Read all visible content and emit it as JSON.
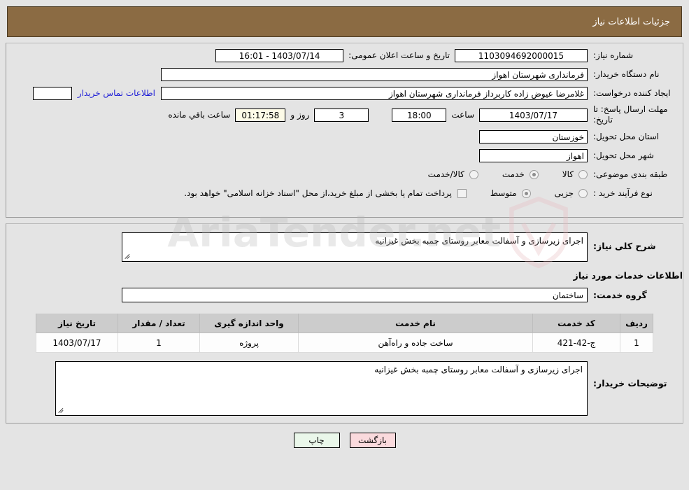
{
  "header": {
    "title": "جزئیات اطلاعات نیاز"
  },
  "top_form": {
    "need_number_label": "شماره نیاز:",
    "need_number_value": "1103094692000015",
    "announce_label": "تاریخ و ساعت اعلان عمومی:",
    "announce_value": "1403/07/14 - 16:01",
    "buyer_org_label": "نام دستگاه خریدار:",
    "buyer_org_value": "فرمانداری شهرستان اهواز",
    "creator_label": "ایجاد کننده درخواست:",
    "creator_value": "غلامرضا عیوض زاده  کاربرداز فرمانداری شهرستان اهواز",
    "contact_link": "اطلاعات تماس خریدار",
    "contact_field_value": "",
    "deadline_label": "مهلت ارسال پاسخ: تا تاریخ:",
    "deadline_date": "1403/07/17",
    "hour_label": "ساعت",
    "deadline_time": "18:00",
    "days_value": "3",
    "days_label": "روز و",
    "countdown_value": "01:17:58",
    "countdown_label": "ساعت باقي مانده",
    "province_label": "استان محل تحویل:",
    "province_value": "خوزستان",
    "city_label": "شهر محل تحویل:",
    "city_value": "اهواز",
    "category_label": "طبقه بندی موضوعی:",
    "category_options": [
      {
        "label": "کالا",
        "checked": false
      },
      {
        "label": "خدمت",
        "checked": true
      },
      {
        "label": "کالا/خدمت",
        "checked": false
      }
    ],
    "process_label": "نوع فرآیند خرید :",
    "process_options": [
      {
        "label": "جزیی",
        "checked": false
      },
      {
        "label": "متوسط",
        "checked": true
      }
    ],
    "payment_checkbox_checked": false,
    "payment_note": "پرداخت تمام یا بخشی از مبلغ خرید،از محل \"اسناد خزانه اسلامی\" خواهد بود."
  },
  "mid": {
    "general_desc_label": "شرح کلی نیاز:",
    "general_desc_value": "اجرای زیرسازی و آسفالت معابر روستای چمبه بخش غیزانیه",
    "services_section_title": "اطلاعات خدمات مورد نیاز",
    "service_group_label": "گروه خدمت:",
    "service_group_value": "ساختمان",
    "table": {
      "headers": [
        "ردیف",
        "کد خدمت",
        "نام خدمت",
        "واحد اندازه گیری",
        "تعداد / مقدار",
        "تاریخ نیاز"
      ],
      "rows": [
        {
          "radif": "1",
          "code": "ج-42-421",
          "name": "ساخت جاده و راه‌آهن",
          "unit": "پروژه",
          "qty": "1",
          "date": "1403/07/17"
        }
      ]
    }
  },
  "bottom": {
    "buyer_notes_label": "توضیحات خریدار:",
    "buyer_notes_value": "اجرای زیرسازی و آسفالت معابر روستای چمبه بخش غیزانیه"
  },
  "footer": {
    "back_label": "بازگشت",
    "print_label": "چاپ"
  },
  "watermark": {
    "text": "AriaTender.net"
  },
  "colors": {
    "header_bar": "#8b6b43",
    "page_bg": "#e4e4e4",
    "link": "#1f1fd6",
    "back_button": "#fadadd",
    "print_button": "#eaf7ea",
    "countdown_bg": "#fdfbe7",
    "table_header": "#cccccc"
  }
}
